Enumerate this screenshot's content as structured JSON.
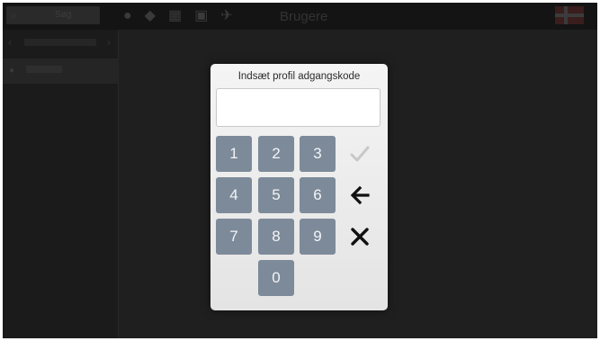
{
  "app": {
    "topbar": {
      "search_text": "Søg",
      "title": "Brugere",
      "icons": [
        "drop-icon",
        "leaf-icon",
        "calendar-icon",
        "window-icon",
        "plane-icon"
      ]
    },
    "flag": "danish-flag-icon"
  },
  "dialog": {
    "title": "Indsæt profil adgangskode",
    "password_value": "",
    "keys": [
      "1",
      "2",
      "3",
      "4",
      "5",
      "6",
      "7",
      "8",
      "9",
      "0"
    ],
    "actions": {
      "confirm": "check-icon",
      "backspace": "arrow-left-icon",
      "cancel": "close-icon"
    },
    "colors": {
      "key_bg": "#7d8a99",
      "key_text": "#f3f5f8",
      "confirm_disabled": "#c8c8c8",
      "action": "#111111"
    }
  }
}
